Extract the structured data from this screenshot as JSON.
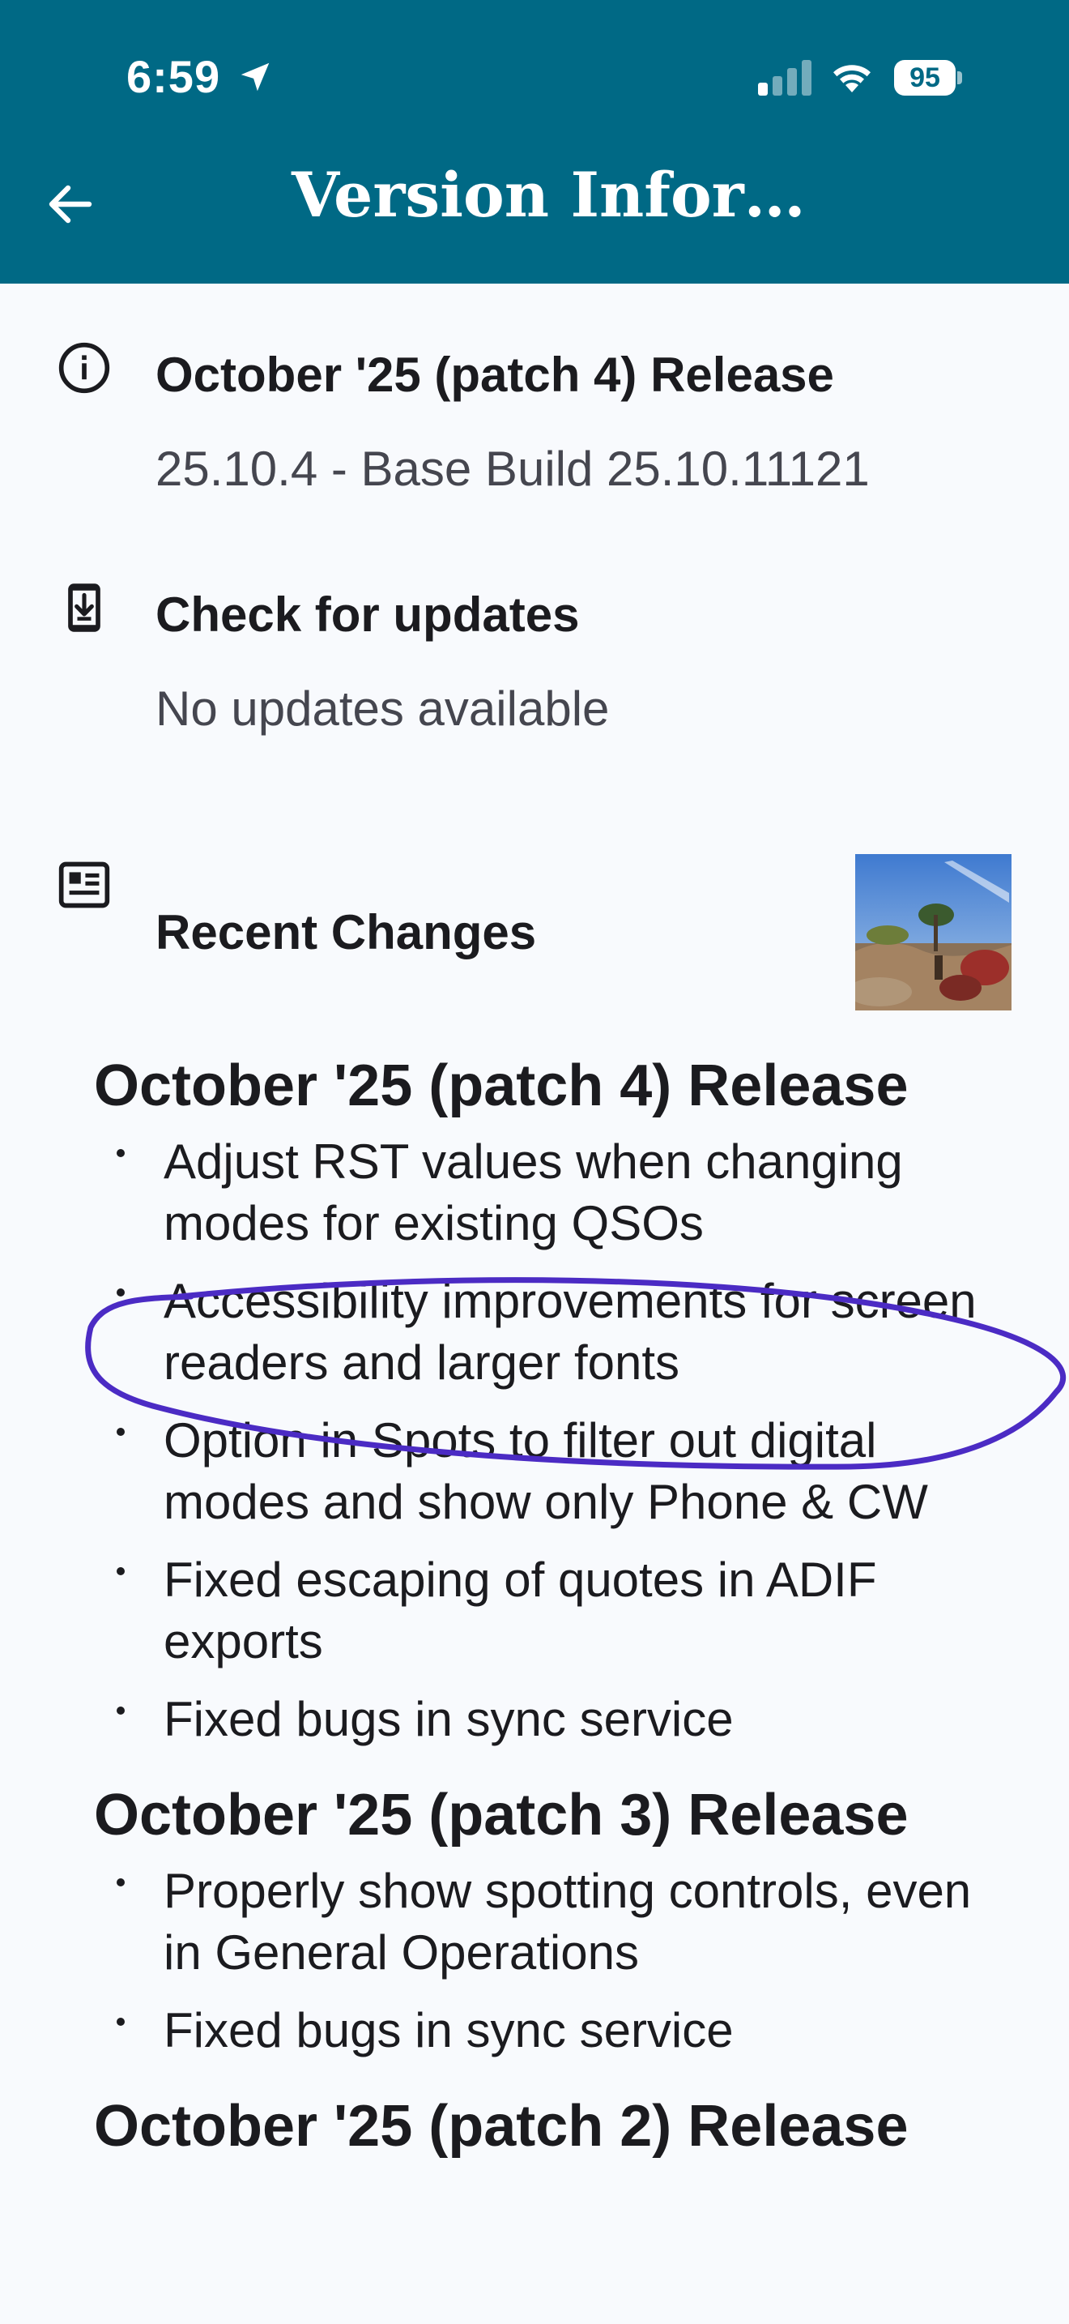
{
  "status_bar": {
    "time": "6:59",
    "battery": "95"
  },
  "appbar": {
    "title": "Version Infor…"
  },
  "version": {
    "title": "October '25 (patch 4) Release",
    "subtitle": "25.10.4 - Base Build 25.10.11121"
  },
  "updates": {
    "title": "Check for updates",
    "subtitle": "No updates available"
  },
  "recent": {
    "title": "Recent Changes"
  },
  "releases": [
    {
      "heading": "October '25 (patch 4) Release",
      "items": [
        "Adjust RST values when changing modes for existing QSOs",
        "Accessibility improvements for screen readers and larger fonts",
        "Option in Spots to filter out digital modes and show only Phone & CW",
        "Fixed escaping of quotes in ADIF exports",
        "Fixed bugs in sync service"
      ]
    },
    {
      "heading": "October '25 (patch 3) Release",
      "items": [
        "Properly show spotting controls, even in General Operations",
        "Fixed bugs in sync service"
      ]
    },
    {
      "heading": "October '25 (patch 2) Release",
      "items": []
    }
  ],
  "colors": {
    "appbar": "#006985",
    "annotation": "#4b2bc4",
    "background": "#f8fafd"
  }
}
